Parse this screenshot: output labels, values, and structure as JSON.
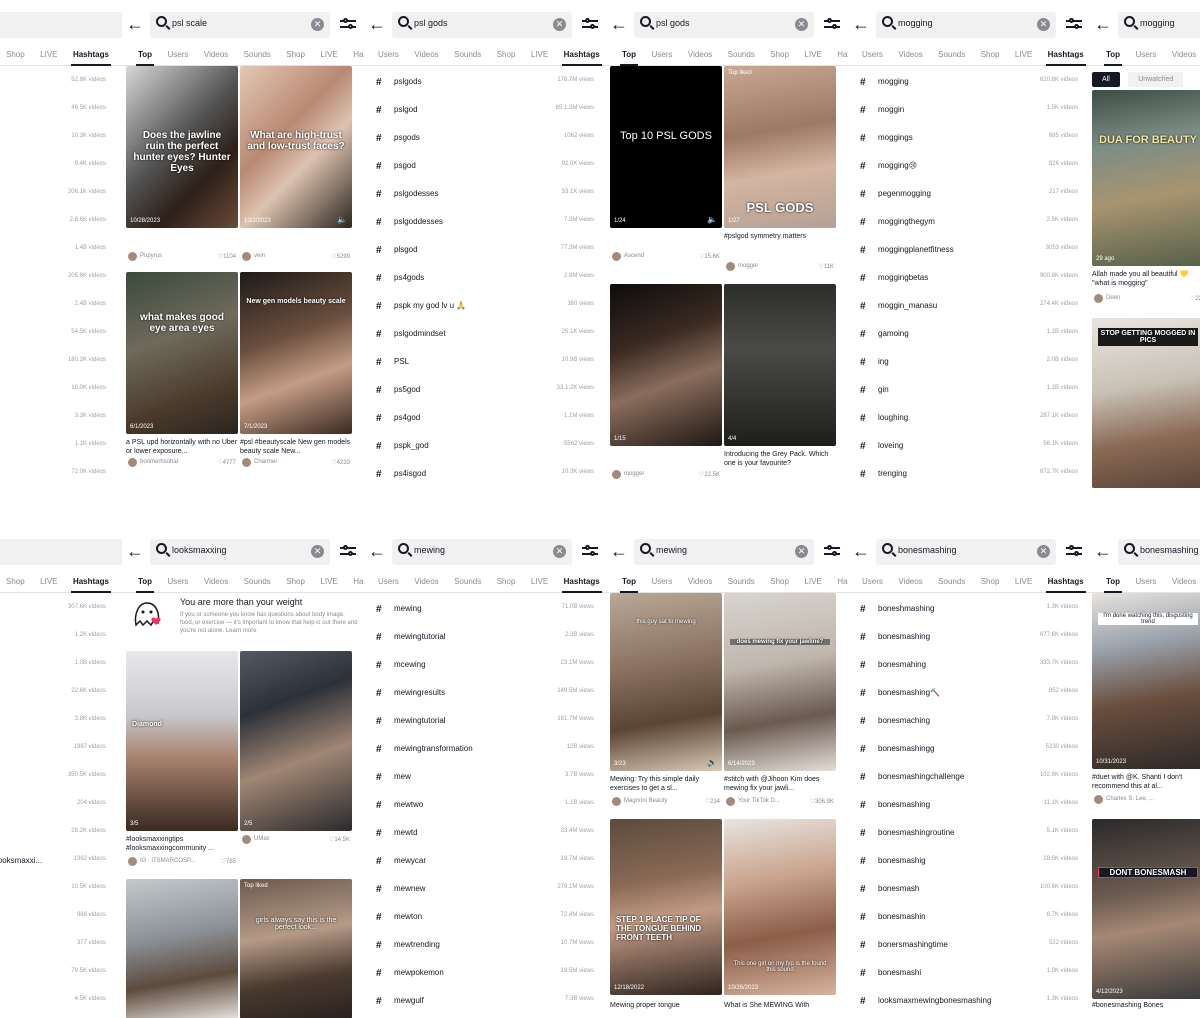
{
  "tabs_full": [
    "Top",
    "Users",
    "Videos",
    "Sounds",
    "Shop",
    "LIVE",
    "Hash"
  ],
  "tabs_hashtag": [
    "Users",
    "Videos",
    "Sounds",
    "Shop",
    "LIVE",
    "Hashtags"
  ],
  "tabs_cut": [
    "Shop",
    "LIVE",
    "Hashtags"
  ],
  "tabs_cut6": [
    "Top",
    "Users",
    "Videos"
  ],
  "panels": {
    "p1": {
      "views": [
        "52.8K videos",
        "46.5K videos",
        "10.3K videos",
        "9.4K videos",
        "206.1K videos",
        "2.8.6K videos",
        "1.4B videos",
        "205.8K videos",
        "2.4B videos",
        "54.5K videos",
        "180.2K videos",
        "10.0K videos",
        "3.3K videos",
        "1.1K videos",
        "72.0K videos"
      ]
    },
    "p2": {
      "query": "psl scale",
      "videos": [
        {
          "overlay": "Does the jawline ruin the perfect hunter eyes?  Hunter Eyes",
          "date": "10/28/2023",
          "caption": "",
          "user": "Pupyrus",
          "likes": "1104"
        },
        {
          "overlay": "What are high-trust and low-trust faces?",
          "date": "10/2/2023",
          "caption": "",
          "user": "vein",
          "likes": "5299"
        },
        {
          "overlay": "what makes good eye area  eyes",
          "date": "6/1/2023",
          "caption": "a PSL upd horizontally with no Uber or lower exposure...",
          "user": "boomerhsohal",
          "likes": "4777"
        },
        {
          "overlay": "New gen models beauty scale",
          "date": "7/1/2023",
          "caption": "#psl #beautyscale New gen models beauty scale New...",
          "user": "Charmer",
          "likes": "4233"
        }
      ]
    },
    "p3": {
      "query": "psl gods",
      "rows": [
        {
          "name": "pslgods",
          "views": "178.7M views"
        },
        {
          "name": "pslgod",
          "views": "65.1.3M views"
        },
        {
          "name": "psgods",
          "views": "1062 views"
        },
        {
          "name": "psgod",
          "views": "92.0K views"
        },
        {
          "name": "pslgodesses",
          "views": "53.1K views"
        },
        {
          "name": "pslgoddesses",
          "views": "7.3M views"
        },
        {
          "name": "plsgod",
          "views": "77.3M views"
        },
        {
          "name": "ps4gods",
          "views": "2.8M views"
        },
        {
          "name": "pspk my god lv u 🙏",
          "views": "360 views"
        },
        {
          "name": "pslgodmindset",
          "views": "25.1K views"
        },
        {
          "name": "PSL",
          "views": "10.9B views"
        },
        {
          "name": "ps5god",
          "views": "33.1.2K views"
        },
        {
          "name": "ps4god",
          "views": "1.1M views"
        },
        {
          "name": "pspk_god",
          "views": "5562 views"
        },
        {
          "name": "ps4isgod",
          "views": "10.3K views"
        }
      ]
    },
    "p4": {
      "query": "psl gods",
      "videos": [
        {
          "overlay": "Top 10 PSL GODS",
          "date": "1/24",
          "caption": "",
          "user": "Ascend",
          "likes": "15.6K"
        },
        {
          "overlay": "PSL GODS",
          "badge": "Top liked",
          "date": "1/27",
          "caption": "#pslgod symmetry matters",
          "user": "mogger",
          "likes": "11K"
        },
        {
          "overlay": "",
          "date": "1/15",
          "caption": "",
          "user": "mogger",
          "likes": "22.5K"
        },
        {
          "overlay": "",
          "date": "4/4",
          "caption": "Introducing the Grey Pack. Which one is your favourite?",
          "user": "",
          "likes": ""
        }
      ]
    },
    "p5": {
      "query": "mogging",
      "rows": [
        {
          "name": "mogging",
          "views": "620.8K videos"
        },
        {
          "name": "moggin",
          "views": "1.5K videos"
        },
        {
          "name": "moggings",
          "views": "685 videos"
        },
        {
          "name": "mogging😢",
          "views": "826 videos"
        },
        {
          "name": "pegenmogging",
          "views": "217 videos"
        },
        {
          "name": "moggingthegym",
          "views": "2.5K videos"
        },
        {
          "name": "moggingplanetfitness",
          "views": "3053 videos"
        },
        {
          "name": "moggingbetas",
          "views": "900.8K videos"
        },
        {
          "name": "moggin_manasu",
          "views": "274.4K videos"
        },
        {
          "name": "gamoing",
          "views": "1.2B videos"
        },
        {
          "name": "ing",
          "views": "2.0B videos"
        },
        {
          "name": "gin",
          "views": "1.2B videos"
        },
        {
          "name": "loughing",
          "views": "287.1K videos"
        },
        {
          "name": "loveing",
          "views": "56.1K videos"
        },
        {
          "name": "trenging",
          "views": "872.7K videos"
        }
      ]
    },
    "p6": {
      "query": "mogging",
      "chips": [
        "All",
        "Unwatched"
      ],
      "videos": [
        {
          "overlay": "DUA FOR BEAUTY",
          "date": "29 ago",
          "caption": "Allah made you all beautiful 💛 \"what is mogging\"",
          "user": "Deen",
          "likes": "22"
        },
        {
          "overlay": "STOP GETTING MOGGED IN PICS",
          "date": "",
          "caption": "",
          "user": "",
          "likes": ""
        }
      ]
    },
    "p7": {
      "views": [
        "307.6K videos",
        "1.2K videos",
        "1.0B videos",
        "22.6K videos",
        "3.8K videos",
        "1987 videos",
        "350.5K videos",
        "204 videos",
        "28.2K videos",
        "1362 videos",
        "10.5K videos",
        "986 videos",
        "377 videos",
        "79.5K videos",
        "4.5K videos"
      ],
      "names": [
        "",
        "",
        "",
        "",
        "",
        "",
        "",
        "",
        "",
        "looksmaxxi...",
        "",
        "",
        "",
        "",
        ""
      ]
    },
    "p8": {
      "query": "looksmaxxing",
      "notice_title": "You are more than your weight",
      "notice_body": "If you or someone you know has questions about body image, food, or exercise — it's important to know that help is out there and you're not alone. Learn more",
      "videos": [
        {
          "overlay": "Diamond",
          "date": "3/5",
          "caption": "#looksmaxxingtips #looksmaxxingcommunity ...",
          "user": "IG : ITSMARCOSP...",
          "likes": "785"
        },
        {
          "overlay": "",
          "date": "2/5",
          "caption": "",
          "user": "UMax",
          "likes": "14.5K"
        },
        {
          "overlay": "",
          "date": "",
          "caption": "",
          "user": "",
          "likes": ""
        },
        {
          "overlay": "girls always say this is the perfect look...",
          "badge": "Top liked",
          "date": "",
          "caption": "",
          "user": "",
          "likes": ""
        }
      ]
    },
    "p9": {
      "query": "mewing",
      "rows": [
        {
          "name": "mewing",
          "views": "71.0B views"
        },
        {
          "name": "mewingtutorial",
          "views": "2.3B views"
        },
        {
          "name": "mcewing",
          "views": "23.1M views"
        },
        {
          "name": "mewingresults",
          "views": "149.5M views"
        },
        {
          "name": "mewingtutorial",
          "views": "161.7M views"
        },
        {
          "name": "mewingtransformation",
          "views": "12B views"
        },
        {
          "name": "mew",
          "views": "3.7B views"
        },
        {
          "name": "mewtwo",
          "views": "1.1B views"
        },
        {
          "name": "mewtd",
          "views": "33.4M views"
        },
        {
          "name": "mewycar",
          "views": "19.7M views"
        },
        {
          "name": "mewnew",
          "views": "279.1M views"
        },
        {
          "name": "mewton",
          "views": "72.4M views"
        },
        {
          "name": "mewtrending",
          "views": "10.7M views"
        },
        {
          "name": "mewpokemon",
          "views": "19.5M views"
        },
        {
          "name": "mewgulf",
          "views": "7.3B views"
        }
      ]
    },
    "p10": {
      "query": "mewing",
      "videos": [
        {
          "overlay": "this guy sat to mewing",
          "date": "3/23",
          "caption": "Mewing: Try this simple daily exercises to get a sl...",
          "user": "Magnoni Beauty",
          "likes": "234"
        },
        {
          "overlay": "does mewing fix your jawline?",
          "date": "6/14/2023",
          "caption": "#stitch with @Jihoon Kim does mewing fix your jawli...",
          "user": "Your TikTok D...",
          "likes": "306.9K"
        },
        {
          "overlay": "STEP 1 PLACE TIP OF THE TONGUE BEHIND FRONT TEETH",
          "date": "12/18/2022",
          "caption": "Mewing proper tongue",
          "user": "",
          "likes": ""
        },
        {
          "overlay": "This one girl on my fyp is the found this sound",
          "date": "10/26/2023",
          "caption": "What is She MEWING With",
          "user": "",
          "likes": ""
        }
      ]
    },
    "p11": {
      "query": "bonesmashing",
      "rows": [
        {
          "name": "boneshmashing",
          "views": "1.3K videos"
        },
        {
          "name": "bonesmashing",
          "views": "677.6K videos"
        },
        {
          "name": "bonesmahing",
          "views": "333.7K videos"
        },
        {
          "name": "bonesmashing🔨",
          "views": "952 videos"
        },
        {
          "name": "bonesmaching",
          "views": "7.9K videos"
        },
        {
          "name": "bonesmashingg",
          "views": "5330 videos"
        },
        {
          "name": "bonesmashingchallenge",
          "views": "102.6K videos"
        },
        {
          "name": "bonesmashing",
          "views": "11.1K videos"
        },
        {
          "name": "bonesmashingroutine",
          "views": "5.1K videos"
        },
        {
          "name": "bonesmashig",
          "views": "28.6K videos"
        },
        {
          "name": "bonesmash",
          "views": "100.6K videos"
        },
        {
          "name": "bonesmashin",
          "views": "6.7K videos"
        },
        {
          "name": "bonersmashingtime",
          "views": "522 videos"
        },
        {
          "name": "bonesmashi",
          "views": "1.0K videos"
        },
        {
          "name": "looksmaxmewingbonesmashing",
          "views": "1.3K videos"
        }
      ]
    },
    "p12": {
      "query": "bonesmashing",
      "videos": [
        {
          "overlay": "I'm done watching this, disgusting trend",
          "date": "10/31/2023",
          "caption": "#duet with @K. Shanti I don't recommend this at al...",
          "user": "Charles S. Lee, ...",
          "likes": ""
        },
        {
          "overlay": "DONT BONESMASH",
          "date": "4/12/2023",
          "caption": "#bonesmashing Bones",
          "user": "",
          "likes": ""
        }
      ]
    }
  }
}
